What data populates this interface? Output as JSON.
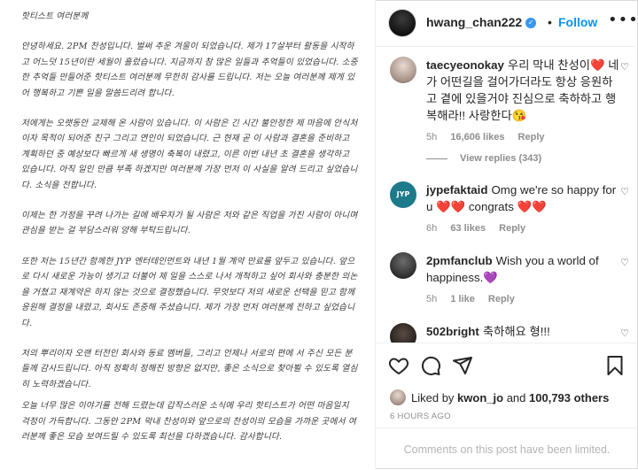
{
  "letter": {
    "greeting": "핫티스트 여러분께",
    "paragraphs": [
      "안녕하세요. 2PM 찬성입니다. 벌써 추운 겨울이 되었습니다. 제가 17살부터 활동을 시작하고 어느덧 15년이란 세월이 흘렀습니다. 지금까지 참 많은 일들과 추억들이 있었습니다. 소중한 추억들 만들어준 핫티스트 여러분께 무한히 감사를 드립니다. 저는 오늘 여러분께 제게 있어 행복하고 기쁜 일을 말씀드리려 합니다.",
      "저에게는 오랫동안 교제해 온 사람이 있습니다. 이 사람은 긴 시간 불안정한 제 마음에 안식처이자 목적이 되어준 친구 그리고 연인이 되었습니다. 근 현재 곧 이 사람과 결혼을 준비하고 계획하던 중 예상보다 빠르게 새 생명이 축복이 내렸고, 이른 이번 내년 초 결혼을 생각하고 있습니다. 아직 일인 만큼 부족 하겠지만 여러분께 가장 먼저 이 사실을 알려 드리고 싶었습니다. 소식을 전합니다.",
      "이제는 한 가정을 꾸려 나가는 길에 배우자가 될 사람은 저와 같은 직업을 가진 사람이 아니며 관심을 받는 걸 부담스러워 양해 부탁드립니다.",
      "또한 저는 15년간 함께한 JYP 엔터테인먼트와 내년 1월 계약 만료를 앞두고 있습니다. 앞으로 다시 새로운 가능이 생기고 더불어 제 일을 스스로 나서 개척하고 싶어 회사와 충분한 의논을 거쳤고 재계약은 하지 않는 것으로 결정했습니다. 무엇보다 저의 새로운 선택을 믿고 함께 응원해 결정을 내렸고, 회사도 존중해 주셨습니다. 제가 가장 먼저 여러분께 전하고 싶었습니다.",
      "저의 뿌리이자 오랜 터전인 회사와 동료 멤버들, 그리고 언제나 서로의 편에 서 주신 모든 분들께 감사드립니다. 아직 정확히 정해진 방향은 없지만, 좋은 소식으로 찾아뵐 수 있도록 열심히 노력하겠습니다.",
      "오늘 너무 많은 이야기를 전해 드렸는데 갑작스러운 소식에 우리 핫티스트가 어떤 마음일지 걱정이 가득합니다. 그동안 2PM 막내 찬성이와 앞으로의 찬성이의 모습을 가까운 곳에서 여러분께 좋은 모습 보여드릴 수 있도록 최선을 다하겠습니다. 감사합니다."
    ]
  },
  "header": {
    "username": "hwang_chan222",
    "verified_icon": "✓",
    "separator": "•",
    "follow_label": "Follow",
    "more_icon": "•••"
  },
  "comments": [
    {
      "username": "taecyeonokay",
      "text": "우리 막내 찬성이❤️ 네가 어떤길을 걸어가더라도 항상 응원하고 곁에 있을거야 진심으로 축하하고 행복해라!! 사랑한다😘",
      "time": "5h",
      "likes": "16,606 likes",
      "reply": "Reply",
      "view_replies": "View replies (343)"
    },
    {
      "username": "jypefaktaid",
      "avatar_text": "JYP",
      "text": "Omg we're so happy for u ❤️❤️ congrats ❤️❤️",
      "time": "6h",
      "likes": "63 likes",
      "reply": "Reply"
    },
    {
      "username": "2pmfanclub",
      "text": "Wish you a world of happiness.💜",
      "time": "5h",
      "likes": "1 like",
      "reply": "Reply"
    },
    {
      "username": "502bright",
      "text": "축하해요 형!!!"
    }
  ],
  "likes": {
    "prefix": "Liked by",
    "user": "kwon_jo",
    "conj": "and",
    "others": "100,793 others"
  },
  "timestamp": "6 HOURS AGO",
  "limited_text": "Comments on this post have been limited.",
  "colors": {
    "accent": "#0095f6",
    "verified": "#3897f0",
    "heart": "#ed4956",
    "muted": "#8e8e8e"
  }
}
